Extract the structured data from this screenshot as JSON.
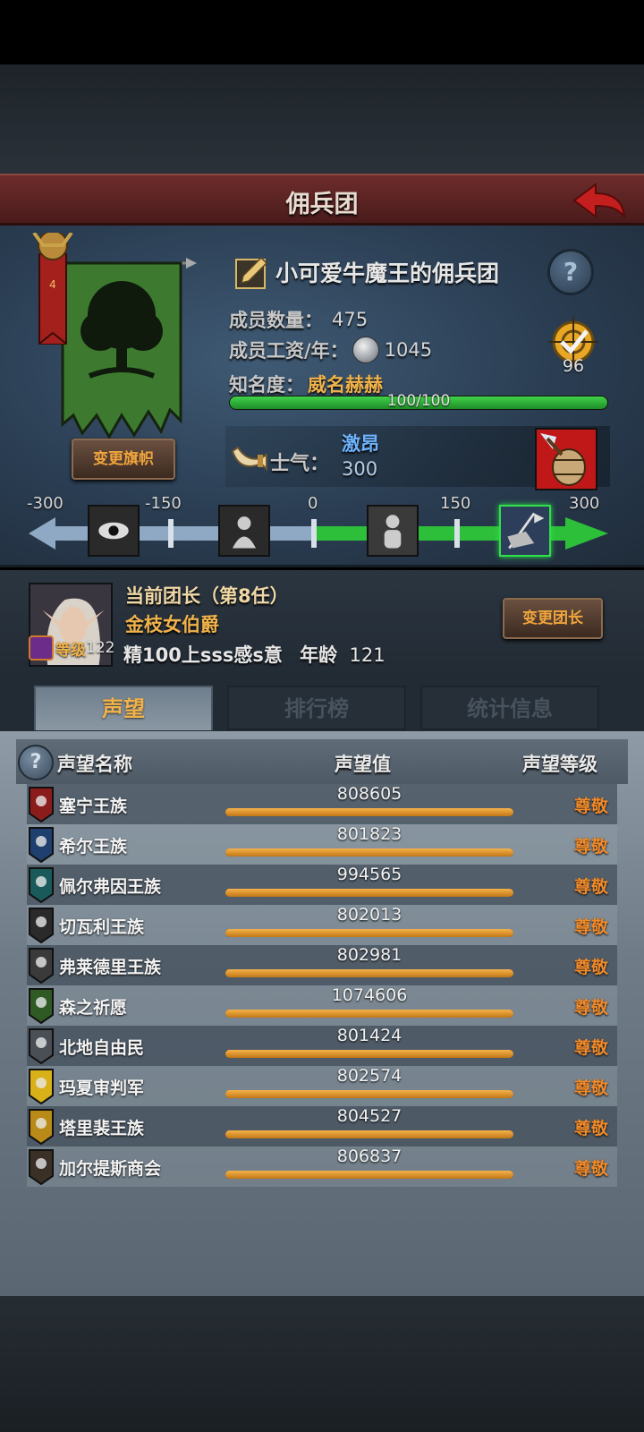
{
  "header": {
    "title": "佣兵团"
  },
  "guild": {
    "name": "小可爱牛魔王的佣兵团",
    "change_banner_label": "变更旗帜",
    "member_count_label": "成员数量：",
    "member_count": "475",
    "wage_label": "成员工资/年：",
    "wage": "1045",
    "fame_label": "知名度：",
    "fame_value": "威名赫赫",
    "fame_progress_text": "100/100",
    "fame_progress": 1.0,
    "medal_value": "96",
    "help_label": "?"
  },
  "morale": {
    "label": "士气：",
    "state": "激昂",
    "value": "300",
    "scale_labels": [
      "-300",
      "-150",
      "0",
      "150",
      "300"
    ],
    "scale_icons": [
      "panic-eye-icon",
      "despair-figure-icon",
      "calm-figure-icon",
      "charge-banner-icon"
    ],
    "active_icon_index": 3
  },
  "leader": {
    "title": "当前团长（第8任）",
    "name": "金枝女伯爵",
    "level_label": "等级",
    "level": "122",
    "nickname": "精100上sss感s意",
    "age_label": "年龄",
    "age": "121",
    "change_leader_label": "变更团长"
  },
  "tabs": [
    {
      "label": "声望",
      "active": true
    },
    {
      "label": "排行榜",
      "active": false
    },
    {
      "label": "统计信息",
      "active": false
    }
  ],
  "reputation": {
    "headers": {
      "help": "?",
      "name": "声望名称",
      "value": "声望值",
      "level": "声望等级"
    },
    "rows": [
      {
        "name": "塞宁王族",
        "value": "808605",
        "level": "尊敬",
        "crest_color": "#8a1c1c",
        "progress": 1.0
      },
      {
        "name": "希尔王族",
        "value": "801823",
        "level": "尊敬",
        "crest_color": "#1f3f6e",
        "progress": 1.0
      },
      {
        "name": "佩尔弗因王族",
        "value": "994565",
        "level": "尊敬",
        "crest_color": "#1a5a5a",
        "progress": 1.0
      },
      {
        "name": "切瓦利王族",
        "value": "802013",
        "level": "尊敬",
        "crest_color": "#2a2a2a",
        "progress": 1.0
      },
      {
        "name": "弗莱德里王族",
        "value": "802981",
        "level": "尊敬",
        "crest_color": "#3a3a3a",
        "progress": 1.0
      },
      {
        "name": "森之祈愿",
        "value": "1074606",
        "level": "尊敬",
        "crest_color": "#2f5a24",
        "progress": 1.0
      },
      {
        "name": "北地自由民",
        "value": "801424",
        "level": "尊敬",
        "crest_color": "#4a4f56",
        "progress": 1.0
      },
      {
        "name": "玛夏审判军",
        "value": "802574",
        "level": "尊敬",
        "crest_color": "#d8b018",
        "progress": 1.0
      },
      {
        "name": "塔里裴王族",
        "value": "804527",
        "level": "尊敬",
        "crest_color": "#b88a18",
        "progress": 1.0
      },
      {
        "name": "加尔提斯商会",
        "value": "806837",
        "level": "尊敬",
        "crest_color": "#3a3026",
        "progress": 1.0
      }
    ]
  },
  "colors": {
    "accent_gold": "#f0b24a",
    "fame_green": "#3ac944",
    "morale_blue": "#6fb3ff",
    "title_red": "#6e2c2c"
  }
}
